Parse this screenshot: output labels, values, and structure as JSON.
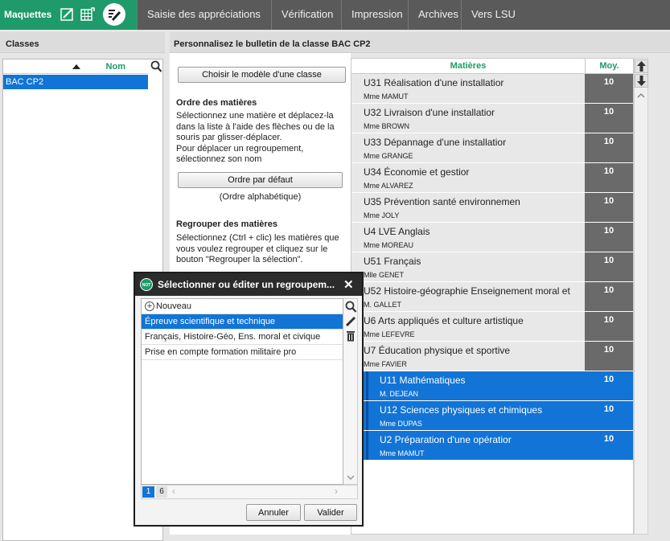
{
  "topbar": {
    "title": "Maquettes",
    "menu": [
      "Saisie des appréciations",
      "Vérification",
      "Impression",
      "Archives",
      "Vers LSU"
    ]
  },
  "left": {
    "title": "Classes",
    "column": "Nom",
    "classes": [
      "BAC CP2"
    ]
  },
  "main": {
    "title": "Personnalisez le bulletin de la classe BAC CP2",
    "choose_model_button": "Choisir le modèle d'une classe",
    "order_title": "Ordre des matières",
    "order_text": "Sélectionnez une matière et déplacez-la\ndans la liste à l'aide des flèches ou de la\nsouris par glisser-déplacer.\nPour déplacer un regroupement,\nsélectionnez son nom",
    "default_order_button": "Ordre par défaut",
    "default_order_note": "(Ordre alphabétique)",
    "group_title": "Regrouper des matières",
    "group_text": "Sélectionnez (Ctrl + clic) les matières que\nvous voulez regrouper et cliquez sur le\nbouton \"Regrouper la sélection\"."
  },
  "subjects": {
    "col_subject": "Matières",
    "col_avg": "Moy.",
    "rows": [
      {
        "name": "U31 Réalisation d'une installatior",
        "teacher": "Mme MAMUT",
        "avg": "10"
      },
      {
        "name": "U32 Livraison d'une installatior",
        "teacher": "Mme BROWN",
        "avg": "10"
      },
      {
        "name": "U33 Dépannage d'une installatior",
        "teacher": "Mme GRANGE",
        "avg": "10"
      },
      {
        "name": "U34 Économie et gestior",
        "teacher": "Mme ALVAREZ",
        "avg": "10"
      },
      {
        "name": "U35 Prévention santé environnemen",
        "teacher": "Mme JOLY",
        "avg": "10"
      },
      {
        "name": "U4 LVE Anglais",
        "teacher": "Mme MOREAU",
        "avg": "10"
      },
      {
        "name": "U51 Français",
        "teacher": "Mlle GENET",
        "avg": "10"
      },
      {
        "name": "U52 Histoire-géographie Enseignement moral et",
        "teacher": "M. GALLET",
        "avg": "10"
      },
      {
        "name": "U6 Arts appliqués et culture artistique",
        "teacher": "Mme LEFEVRE",
        "avg": "10"
      },
      {
        "name": "U7 Éducation physique et sportive",
        "teacher": "Mme FAVIER",
        "avg": "10"
      },
      {
        "name": "U11 Mathématiques",
        "teacher": "M. DEJEAN",
        "avg": "10"
      },
      {
        "name": "U12 Sciences physiques et chimiques",
        "teacher": "Mme DUPAS",
        "avg": "10"
      },
      {
        "name": "U2 Préparation d'une opératior",
        "teacher": "Mme MAMUT",
        "avg": "10"
      }
    ]
  },
  "dialog": {
    "logo": "NOT",
    "title": "Sélectionner ou éditer un regroupem...",
    "new_label": "Nouveau",
    "items": [
      "Épreuve scientifique et technique",
      "Français, Histoire-Géo, Ens. moral et civique",
      "Prise en compte formation militaire pro"
    ],
    "pages": [
      "1",
      "6"
    ],
    "cancel": "Annuler",
    "validate": "Valider"
  },
  "colors": {
    "brand": "#1f9a6a",
    "selection": "#1174d6",
    "topbar": "#5a5a5a"
  }
}
